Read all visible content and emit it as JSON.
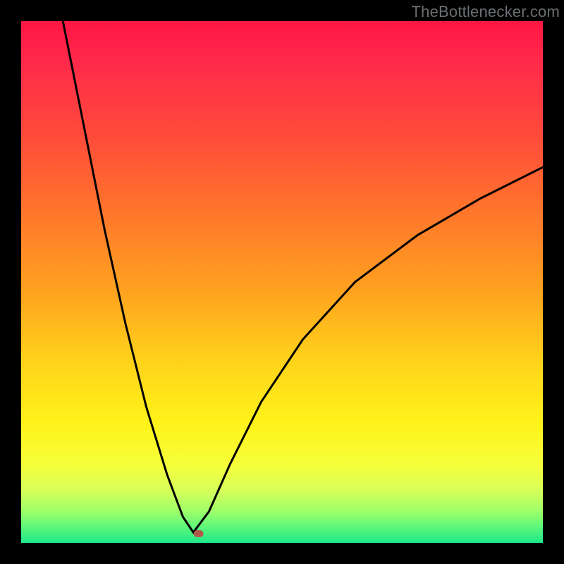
{
  "watermark": "TheBottlenecker.com",
  "chart_data": {
    "type": "line",
    "title": "",
    "xlabel": "",
    "ylabel": "",
    "xlim": [
      0,
      1
    ],
    "ylim": [
      0,
      1
    ],
    "notch": {
      "x": 0.33,
      "y": 0.98
    },
    "left_branch_top": {
      "x": 0.08,
      "y": 0.0
    },
    "right_branch_end": {
      "x": 1.0,
      "y": 0.28
    },
    "x": [
      0.08,
      0.12,
      0.16,
      0.2,
      0.24,
      0.28,
      0.31,
      0.33,
      0.36,
      0.4,
      0.46,
      0.54,
      0.64,
      0.76,
      0.88,
      1.0
    ],
    "values": [
      0.0,
      0.2,
      0.4,
      0.58,
      0.74,
      0.87,
      0.95,
      0.98,
      0.94,
      0.85,
      0.73,
      0.61,
      0.5,
      0.41,
      0.34,
      0.28
    ],
    "background_gradient": {
      "top_color": "#ff1744",
      "mid_color": "#fff31a",
      "bottom_color": "#1de88a"
    },
    "marker": {
      "shape": "rounded-rect",
      "x": 0.34,
      "y": 0.985,
      "color": "#b05a4a"
    }
  }
}
